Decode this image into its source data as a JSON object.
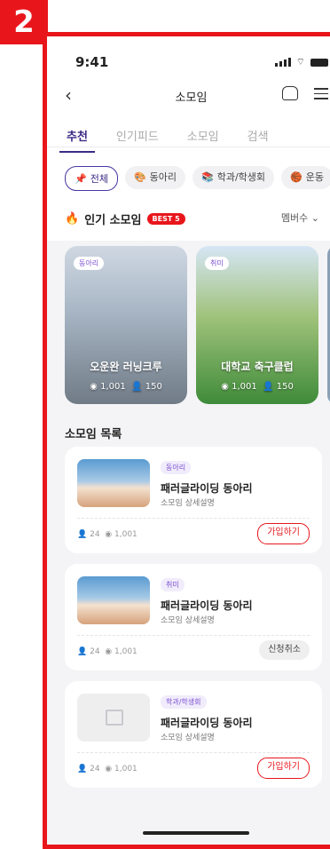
{
  "step_number": "2",
  "status_bar": {
    "time": "9:41"
  },
  "header": {
    "back_icon": "chevron-left-icon",
    "title": "소모임",
    "home_icon": "home-icon",
    "menu_icon": "menu-icon"
  },
  "tabs": [
    {
      "label": "추천",
      "active": true
    },
    {
      "label": "인기피드",
      "active": false
    },
    {
      "label": "소모임",
      "active": false
    },
    {
      "label": "검색",
      "active": false
    }
  ],
  "chips": [
    {
      "icon": "📌",
      "label": "전체",
      "active": true
    },
    {
      "icon": "🎨",
      "label": "동아리",
      "active": false
    },
    {
      "icon": "📚",
      "label": "학과/학생회",
      "active": false
    },
    {
      "icon": "🏀",
      "label": "운동",
      "active": false
    }
  ],
  "popular": {
    "icon": "🔥",
    "title": "인기 소모임",
    "badge": "BEST 5",
    "sort_label": "멤버수 ⌄",
    "cards": [
      {
        "tag": "동아리",
        "name": "오운완 러닝크루",
        "views": "1,001",
        "members": "150"
      },
      {
        "tag": "취미",
        "name": "대학교 축구클럽",
        "views": "1,001",
        "members": "150"
      }
    ]
  },
  "list": {
    "title": "소모임 목록",
    "items": [
      {
        "tag": "동아리",
        "name": "패러글라이딩 동아리",
        "desc": "소모임 상세설명",
        "members": "24",
        "views": "1,001",
        "button": "가입하기"
      },
      {
        "tag": "취미",
        "name": "패러글라이딩 동아리",
        "desc": "소모임 상세설명",
        "members": "24",
        "views": "1,001",
        "button": "신청취소"
      },
      {
        "tag": "학과/학생회",
        "name": "패러글라이딩 동아리",
        "desc": "소모임 상세설명",
        "members": "24",
        "views": "1,001",
        "button": "가입하기"
      }
    ]
  },
  "colors": {
    "accent": "#3d2a86",
    "highlight": "#e8161b",
    "tag_text": "#7a4fd3"
  }
}
